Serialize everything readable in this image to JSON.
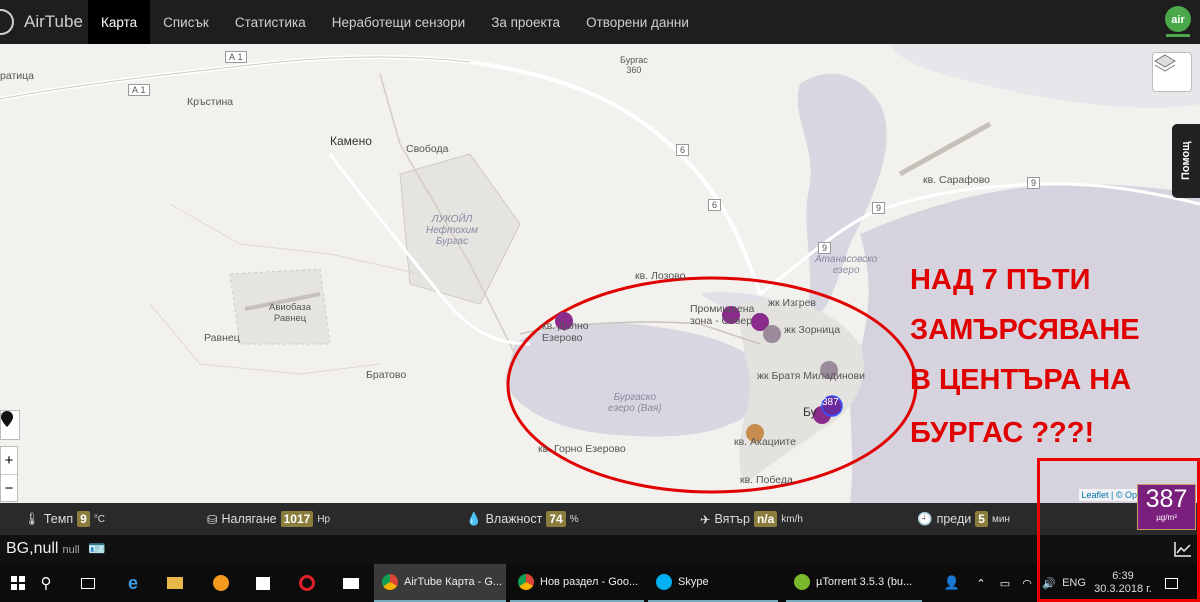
{
  "brand": {
    "name": "AirTube"
  },
  "nav": [
    "Карта",
    "Списък",
    "Статистика",
    "Неработещи сензори",
    "За проекта",
    "Отворени данни"
  ],
  "nav_active": 0,
  "map": {
    "labels": {
      "ratica": "ратица",
      "krastina": "Кръстина",
      "kameno": "Камено",
      "svoboda": "Свобода",
      "lukoil": "ЛУКОЙЛ\nНефтохим\nБургас",
      "avio": "Авиобаза\nРавнец",
      "ravnets": "Равнец",
      "bratovo": "Братово",
      "burgas360": "Бургас\n360",
      "sarafovo": "кв. Сарафово",
      "atanasovsko": "Атанасовско\nезеро",
      "lozovo": "кв. Лозово",
      "promishlena": "Промишлена\nзона - Север",
      "izgrev": "жк Изгрев",
      "zornitsa": "жк Зорница",
      "bratya": "жк Братя Миладинови",
      "ezerovo": "кв. Долно\nЕзерово",
      "burgasko": "Бургаско\nезеро (Вая)",
      "gorno": "кв. Горно Езерово",
      "akatsiite": "кв. Акациите",
      "pobeda": "кв. Победа",
      "bu": "Бу"
    },
    "roads": {
      "a1a": "А 1",
      "a1b": "А 1",
      "r6a": "6",
      "r6b": "6",
      "r9a": "9",
      "r9b": "9",
      "r9c": "9"
    },
    "marker_label": "387",
    "help": "Помощ",
    "attribution": "Leaflet | © Op",
    "zoom_in": "+",
    "zoom_out": "−"
  },
  "annotation": {
    "lines": [
      "НАД 7 ПЪТИ",
      "ЗАМЪРСЯВАНЕ",
      "В ЦЕНТЪРА НА",
      "БУРГАС ???!"
    ],
    "color": "#e00000"
  },
  "status": {
    "temp": {
      "label": "Темп",
      "value": "9",
      "unit": "°C"
    },
    "pressure": {
      "label": "Налягане",
      "value": "1017",
      "unit": "Hp"
    },
    "humidity": {
      "label": "Влажност",
      "value": "74",
      "unit": "%"
    },
    "wind": {
      "label": "Вятър",
      "value": "n/a",
      "unit": "km/h"
    },
    "ago": {
      "label": "преди",
      "value": "5",
      "unit": "мин"
    }
  },
  "aqi": {
    "value": "387",
    "unit": "µg/m³",
    "color": "#7a1f7d"
  },
  "sensor": {
    "name": "BG,null",
    "sub": "null"
  },
  "taskbar": {
    "tasks": [
      "AirTube Карта - G...",
      "Нов раздел - Goo...",
      "Skype",
      "µTorrent 3.5.3  (bu..."
    ],
    "lang": "ENG",
    "time": "6:39",
    "date": "30.3.2018 г."
  }
}
